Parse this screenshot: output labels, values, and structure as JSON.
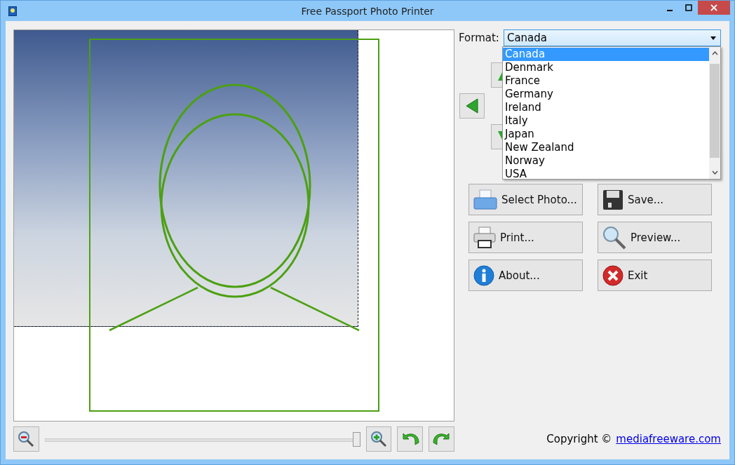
{
  "window": {
    "title": "Free Passport Photo Printer"
  },
  "format": {
    "label": "Format:",
    "value": "Canada",
    "options": [
      {
        "label": "Canada",
        "selected": true
      },
      {
        "label": "Denmark",
        "selected": false
      },
      {
        "label": "France",
        "selected": false
      },
      {
        "label": "Germany",
        "selected": false
      },
      {
        "label": "Ireland",
        "selected": false
      },
      {
        "label": "Italy",
        "selected": false
      },
      {
        "label": "Japan",
        "selected": false
      },
      {
        "label": "New Zealand",
        "selected": false
      },
      {
        "label": "Norway",
        "selected": false
      },
      {
        "label": "USA",
        "selected": false
      }
    ]
  },
  "buttons": [
    {
      "label": "Select Photo...",
      "kind": "open"
    },
    {
      "label": "Save...",
      "kind": "save"
    },
    {
      "label": "Print...",
      "kind": "print"
    },
    {
      "label": "Preview...",
      "kind": "preview"
    },
    {
      "label": "About...",
      "kind": "about"
    },
    {
      "label": "Exit",
      "kind": "exit"
    }
  ],
  "zoom_slider": {
    "level": 0.99
  },
  "copyright": {
    "text": "Copyright ©",
    "link": "mediafreeware.com"
  }
}
